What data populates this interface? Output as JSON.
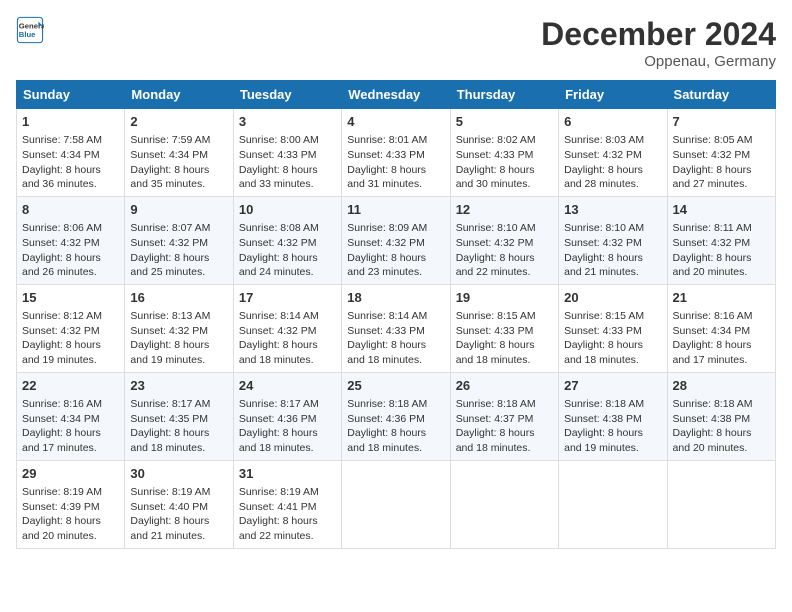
{
  "header": {
    "logo_line1": "General",
    "logo_line2": "Blue",
    "month": "December 2024",
    "location": "Oppenau, Germany"
  },
  "days_of_week": [
    "Sunday",
    "Monday",
    "Tuesday",
    "Wednesday",
    "Thursday",
    "Friday",
    "Saturday"
  ],
  "weeks": [
    [
      {
        "day": 1,
        "lines": [
          "Sunrise: 7:58 AM",
          "Sunset: 4:34 PM",
          "Daylight: 8 hours",
          "and 36 minutes."
        ]
      },
      {
        "day": 2,
        "lines": [
          "Sunrise: 7:59 AM",
          "Sunset: 4:34 PM",
          "Daylight: 8 hours",
          "and 35 minutes."
        ]
      },
      {
        "day": 3,
        "lines": [
          "Sunrise: 8:00 AM",
          "Sunset: 4:33 PM",
          "Daylight: 8 hours",
          "and 33 minutes."
        ]
      },
      {
        "day": 4,
        "lines": [
          "Sunrise: 8:01 AM",
          "Sunset: 4:33 PM",
          "Daylight: 8 hours",
          "and 31 minutes."
        ]
      },
      {
        "day": 5,
        "lines": [
          "Sunrise: 8:02 AM",
          "Sunset: 4:33 PM",
          "Daylight: 8 hours",
          "and 30 minutes."
        ]
      },
      {
        "day": 6,
        "lines": [
          "Sunrise: 8:03 AM",
          "Sunset: 4:32 PM",
          "Daylight: 8 hours",
          "and 28 minutes."
        ]
      },
      {
        "day": 7,
        "lines": [
          "Sunrise: 8:05 AM",
          "Sunset: 4:32 PM",
          "Daylight: 8 hours",
          "and 27 minutes."
        ]
      }
    ],
    [
      {
        "day": 8,
        "lines": [
          "Sunrise: 8:06 AM",
          "Sunset: 4:32 PM",
          "Daylight: 8 hours",
          "and 26 minutes."
        ]
      },
      {
        "day": 9,
        "lines": [
          "Sunrise: 8:07 AM",
          "Sunset: 4:32 PM",
          "Daylight: 8 hours",
          "and 25 minutes."
        ]
      },
      {
        "day": 10,
        "lines": [
          "Sunrise: 8:08 AM",
          "Sunset: 4:32 PM",
          "Daylight: 8 hours",
          "and 24 minutes."
        ]
      },
      {
        "day": 11,
        "lines": [
          "Sunrise: 8:09 AM",
          "Sunset: 4:32 PM",
          "Daylight: 8 hours",
          "and 23 minutes."
        ]
      },
      {
        "day": 12,
        "lines": [
          "Sunrise: 8:10 AM",
          "Sunset: 4:32 PM",
          "Daylight: 8 hours",
          "and 22 minutes."
        ]
      },
      {
        "day": 13,
        "lines": [
          "Sunrise: 8:10 AM",
          "Sunset: 4:32 PM",
          "Daylight: 8 hours",
          "and 21 minutes."
        ]
      },
      {
        "day": 14,
        "lines": [
          "Sunrise: 8:11 AM",
          "Sunset: 4:32 PM",
          "Daylight: 8 hours",
          "and 20 minutes."
        ]
      }
    ],
    [
      {
        "day": 15,
        "lines": [
          "Sunrise: 8:12 AM",
          "Sunset: 4:32 PM",
          "Daylight: 8 hours",
          "and 19 minutes."
        ]
      },
      {
        "day": 16,
        "lines": [
          "Sunrise: 8:13 AM",
          "Sunset: 4:32 PM",
          "Daylight: 8 hours",
          "and 19 minutes."
        ]
      },
      {
        "day": 17,
        "lines": [
          "Sunrise: 8:14 AM",
          "Sunset: 4:32 PM",
          "Daylight: 8 hours",
          "and 18 minutes."
        ]
      },
      {
        "day": 18,
        "lines": [
          "Sunrise: 8:14 AM",
          "Sunset: 4:33 PM",
          "Daylight: 8 hours",
          "and 18 minutes."
        ]
      },
      {
        "day": 19,
        "lines": [
          "Sunrise: 8:15 AM",
          "Sunset: 4:33 PM",
          "Daylight: 8 hours",
          "and 18 minutes."
        ]
      },
      {
        "day": 20,
        "lines": [
          "Sunrise: 8:15 AM",
          "Sunset: 4:33 PM",
          "Daylight: 8 hours",
          "and 18 minutes."
        ]
      },
      {
        "day": 21,
        "lines": [
          "Sunrise: 8:16 AM",
          "Sunset: 4:34 PM",
          "Daylight: 8 hours",
          "and 17 minutes."
        ]
      }
    ],
    [
      {
        "day": 22,
        "lines": [
          "Sunrise: 8:16 AM",
          "Sunset: 4:34 PM",
          "Daylight: 8 hours",
          "and 17 minutes."
        ]
      },
      {
        "day": 23,
        "lines": [
          "Sunrise: 8:17 AM",
          "Sunset: 4:35 PM",
          "Daylight: 8 hours",
          "and 18 minutes."
        ]
      },
      {
        "day": 24,
        "lines": [
          "Sunrise: 8:17 AM",
          "Sunset: 4:36 PM",
          "Daylight: 8 hours",
          "and 18 minutes."
        ]
      },
      {
        "day": 25,
        "lines": [
          "Sunrise: 8:18 AM",
          "Sunset: 4:36 PM",
          "Daylight: 8 hours",
          "and 18 minutes."
        ]
      },
      {
        "day": 26,
        "lines": [
          "Sunrise: 8:18 AM",
          "Sunset: 4:37 PM",
          "Daylight: 8 hours",
          "and 18 minutes."
        ]
      },
      {
        "day": 27,
        "lines": [
          "Sunrise: 8:18 AM",
          "Sunset: 4:38 PM",
          "Daylight: 8 hours",
          "and 19 minutes."
        ]
      },
      {
        "day": 28,
        "lines": [
          "Sunrise: 8:18 AM",
          "Sunset: 4:38 PM",
          "Daylight: 8 hours",
          "and 20 minutes."
        ]
      }
    ],
    [
      {
        "day": 29,
        "lines": [
          "Sunrise: 8:19 AM",
          "Sunset: 4:39 PM",
          "Daylight: 8 hours",
          "and 20 minutes."
        ]
      },
      {
        "day": 30,
        "lines": [
          "Sunrise: 8:19 AM",
          "Sunset: 4:40 PM",
          "Daylight: 8 hours",
          "and 21 minutes."
        ]
      },
      {
        "day": 31,
        "lines": [
          "Sunrise: 8:19 AM",
          "Sunset: 4:41 PM",
          "Daylight: 8 hours",
          "and 22 minutes."
        ]
      },
      null,
      null,
      null,
      null
    ]
  ]
}
